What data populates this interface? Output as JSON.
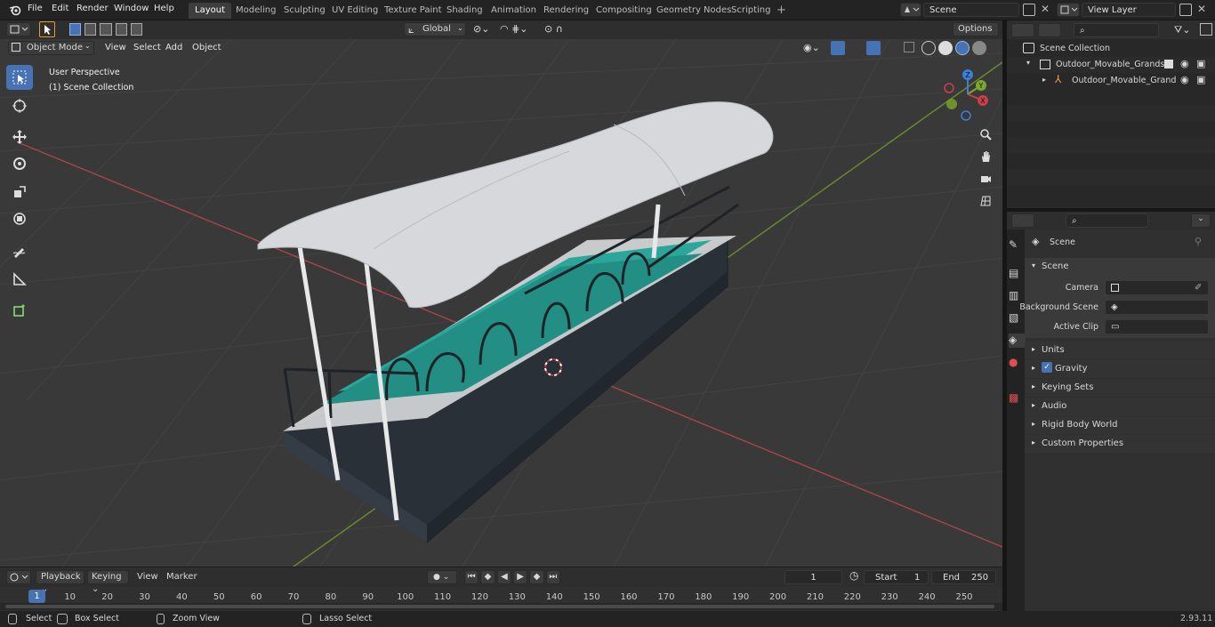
{
  "menus": [
    "File",
    "Edit",
    "Render",
    "Window",
    "Help"
  ],
  "workspaces": [
    {
      "label": "Layout",
      "active": true
    },
    {
      "label": "Modeling"
    },
    {
      "label": "Sculpting"
    },
    {
      "label": "UV Editing"
    },
    {
      "label": "Texture Paint"
    },
    {
      "label": "Shading"
    },
    {
      "label": "Animation"
    },
    {
      "label": "Rendering"
    },
    {
      "label": "Compositing"
    },
    {
      "label": "Geometry Nodes"
    },
    {
      "label": "Scripting"
    }
  ],
  "add_workspace": "+",
  "scene_field": "Scene",
  "view_layer_field": "View Layer",
  "viewport_header": {
    "mode": "Object Mode",
    "menus": [
      "View",
      "Select",
      "Add",
      "Object"
    ],
    "orientation": "Global",
    "options": "Options"
  },
  "viewport_overlay": {
    "perspective": "User Perspective",
    "collection": "(1) Scene Collection"
  },
  "gizmo_axes": {
    "x": "X",
    "y": "Y",
    "z": "Z"
  },
  "outliner": {
    "search_placeholder": "",
    "root": "Scene Collection",
    "collection": "Outdoor_Movable_Grandstan",
    "object": "Outdoor_Movable_Grand"
  },
  "properties": {
    "header": "Scene",
    "section": "Scene",
    "fields": [
      {
        "label": "Camera"
      },
      {
        "label": "Background Scene"
      },
      {
        "label": "Active Clip"
      }
    ],
    "panels": [
      "Units",
      "Gravity",
      "Keying Sets",
      "Audio",
      "Rigid Body World",
      "Custom Properties"
    ],
    "gravity_checked": true
  },
  "timeline": {
    "menus": [
      "Playback",
      "Keying",
      "View",
      "Marker"
    ],
    "current_frame": "1",
    "start_label": "Start",
    "start_value": "1",
    "end_label": "End",
    "end_value": "250",
    "frame_marker": "1",
    "ticks": [
      "10",
      "20",
      "30",
      "40",
      "50",
      "60",
      "70",
      "80",
      "90",
      "100",
      "110",
      "120",
      "130",
      "140",
      "150",
      "160",
      "170",
      "180",
      "190",
      "200",
      "210",
      "220",
      "230",
      "240",
      "250"
    ]
  },
  "status_bar": {
    "select": "Select",
    "box_select": "Box Select",
    "zoom_view": "Zoom View",
    "lasso_select": "Lasso Select",
    "version": "2.93.11"
  },
  "colors": {
    "accent": "#4772b3",
    "x_axis": "#c8404a",
    "y_axis": "#7ba82a",
    "z_axis": "#3d7fd6",
    "seat": "#2aa69a",
    "roof": "#d6d8dc",
    "base": "#2a3038"
  }
}
